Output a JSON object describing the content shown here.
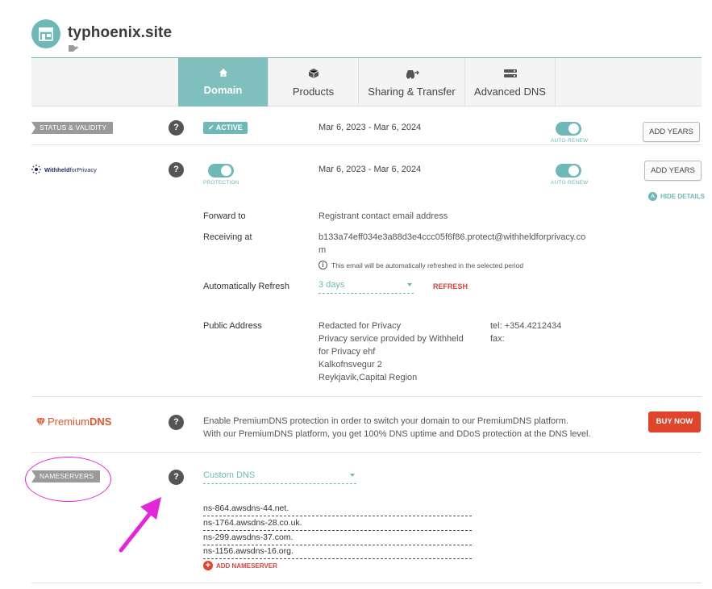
{
  "header": {
    "domain_name": "typhoenix.site",
    "logo_icon": "storefront-icon",
    "tag_icon": "tag-add-icon"
  },
  "tabs": [
    {
      "label": "Domain",
      "icon": "home-icon",
      "active": true
    },
    {
      "label": "Products",
      "icon": "box-icon",
      "active": false
    },
    {
      "label": "Sharing & Transfer",
      "icon": "car-transfer-icon",
      "active": false
    },
    {
      "label": "Advanced DNS",
      "icon": "server-icon",
      "active": false
    }
  ],
  "status": {
    "label": "STATUS & VALIDITY",
    "badge": "ACTIVE",
    "dates": "Mar 6, 2023 - Mar 6, 2024",
    "autorenew_caption": "AUTO-RENEW",
    "add_years_label": "ADD YEARS"
  },
  "privacy": {
    "brand_left": "Withheld",
    "brand_right": "forPrivacy",
    "protection_caption": "PROTECTION",
    "dates": "Mar 6, 2023 - Mar 6, 2024",
    "autorenew_caption": "AUTO-RENEW",
    "add_years_label": "ADD YEARS",
    "hide_details_label": "HIDE DETAILS",
    "forward_to_label": "Forward to",
    "forward_to_value": "Registrant contact email address",
    "receiving_at_label": "Receiving at",
    "receiving_at_line1": "b133a74eff034e3a88d3e4ccc05f6f86.protect@withheldforprivacy.co",
    "receiving_at_line2": "m",
    "refresh_note": "This email will be automatically refreshed in the selected period",
    "auto_refresh_label": "Automatically Refresh",
    "auto_refresh_value": "3 days",
    "refresh_button": "REFRESH",
    "public_address_label": "Public Address",
    "address_lines": [
      "Redacted for Privacy",
      "Privacy service provided by Withheld",
      "for Privacy ehf",
      "Kalkofnsvegur 2",
      "Reykjavik,Capital Region"
    ],
    "tel": "tel: +354.4212434",
    "fax": "fax:"
  },
  "premium_dns": {
    "brand_left": "Premium",
    "brand_right": "DNS",
    "desc_line1": "Enable PremiumDNS protection in order to switch your domain to our PremiumDNS platform.",
    "desc_line2": "With our PremiumDNS platform, you get 100% DNS uptime and DDoS protection at the DNS level.",
    "buy_label": "BUY NOW"
  },
  "nameservers": {
    "label": "NAMESERVERS",
    "mode": "Custom DNS",
    "entries": [
      "ns-864.awsdns-44.net.",
      "ns-1764.awsdns-28.co.uk.",
      "ns-299.awsdns-37.com.",
      "ns-1156.awsdns-16.org."
    ],
    "add_label": "ADD NAMESERVER"
  },
  "help_symbol": "?",
  "colors": {
    "accent": "#6fb8b8",
    "danger": "#e0452c",
    "annotation": "#e426d9"
  }
}
